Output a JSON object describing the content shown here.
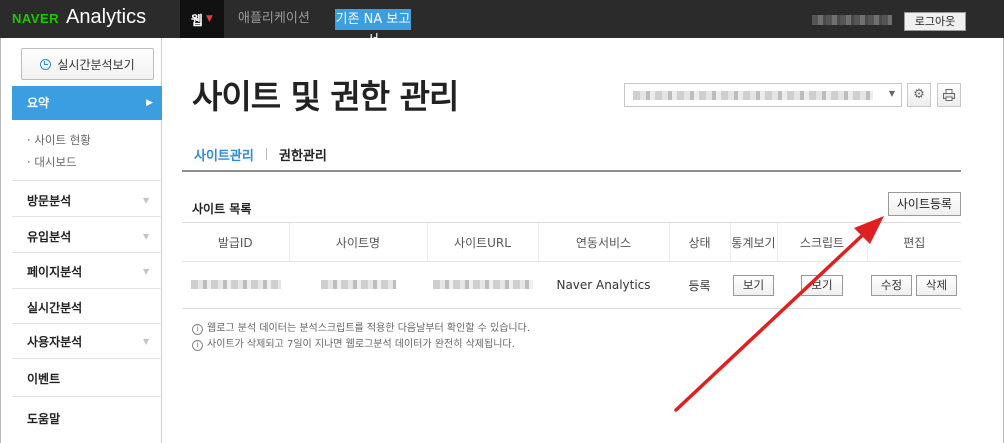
{
  "topbar": {
    "brand_naver": "NAVER",
    "brand_app": "Analytics",
    "nav_web": "웹",
    "nav_app": "애플리케이션",
    "nav_legacy": "기존 NA 보고서",
    "logout": "로그아웃"
  },
  "sidebar": {
    "realtime_button": "실시간분석보기",
    "active_item": "요약",
    "sub_items": [
      "사이트 현황",
      "대시보드"
    ],
    "items": [
      "방문분석",
      "유입분석",
      "페이지분석",
      "실시간분석",
      "사용자분석",
      "이벤트",
      "도움말"
    ]
  },
  "main": {
    "title": "사이트 및 권한 관리",
    "tabs": [
      "사이트관리",
      "권한관리"
    ],
    "section_title": "사이트 목록",
    "register_button": "사이트등록",
    "table": {
      "headers": [
        "발급ID",
        "사이트명",
        "사이트URL",
        "연동서비스",
        "상태",
        "통계보기",
        "스크립트",
        "편집"
      ],
      "row": {
        "service": "Naver Analytics",
        "status": "등록",
        "view_button": "보기",
        "script_button": "보기",
        "edit_button": "수정",
        "delete_button": "삭제"
      }
    },
    "notes": [
      "웹로그 분석 데이터는 분석스크립트를 적용한 다음날부터 확인할 수 있습니다.",
      "사이트가 삭제되고 7일이 지나면 웹로그분석 데이터가 완전히 삭제됩니다."
    ]
  },
  "colors": {
    "accent": "#3a9ee0",
    "brand_green": "#1ec800",
    "topbar": "#2b2b2b",
    "annotation_arrow": "#e02020"
  }
}
